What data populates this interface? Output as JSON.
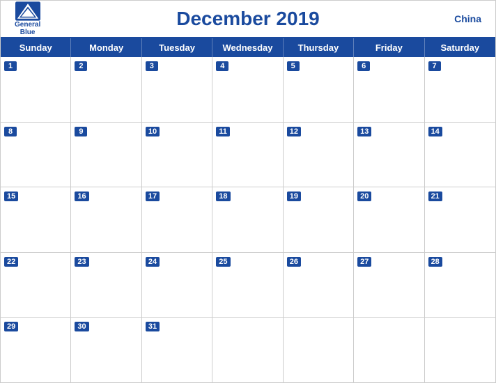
{
  "header": {
    "logo_line1": "General",
    "logo_line2": "Blue",
    "title": "December 2019",
    "country": "China"
  },
  "days_of_week": [
    "Sunday",
    "Monday",
    "Tuesday",
    "Wednesday",
    "Thursday",
    "Friday",
    "Saturday"
  ],
  "weeks": [
    [
      {
        "num": "1",
        "empty": false
      },
      {
        "num": "2",
        "empty": false
      },
      {
        "num": "3",
        "empty": false
      },
      {
        "num": "4",
        "empty": false
      },
      {
        "num": "5",
        "empty": false
      },
      {
        "num": "6",
        "empty": false
      },
      {
        "num": "7",
        "empty": false
      }
    ],
    [
      {
        "num": "8",
        "empty": false
      },
      {
        "num": "9",
        "empty": false
      },
      {
        "num": "10",
        "empty": false
      },
      {
        "num": "11",
        "empty": false
      },
      {
        "num": "12",
        "empty": false
      },
      {
        "num": "13",
        "empty": false
      },
      {
        "num": "14",
        "empty": false
      }
    ],
    [
      {
        "num": "15",
        "empty": false
      },
      {
        "num": "16",
        "empty": false
      },
      {
        "num": "17",
        "empty": false
      },
      {
        "num": "18",
        "empty": false
      },
      {
        "num": "19",
        "empty": false
      },
      {
        "num": "20",
        "empty": false
      },
      {
        "num": "21",
        "empty": false
      }
    ],
    [
      {
        "num": "22",
        "empty": false
      },
      {
        "num": "23",
        "empty": false
      },
      {
        "num": "24",
        "empty": false
      },
      {
        "num": "25",
        "empty": false
      },
      {
        "num": "26",
        "empty": false
      },
      {
        "num": "27",
        "empty": false
      },
      {
        "num": "28",
        "empty": false
      }
    ],
    [
      {
        "num": "29",
        "empty": false
      },
      {
        "num": "30",
        "empty": false
      },
      {
        "num": "31",
        "empty": false
      },
      {
        "num": "",
        "empty": true
      },
      {
        "num": "",
        "empty": true
      },
      {
        "num": "",
        "empty": true
      },
      {
        "num": "",
        "empty": true
      }
    ]
  ],
  "colors": {
    "blue": "#1a4a9e",
    "white": "#ffffff"
  }
}
